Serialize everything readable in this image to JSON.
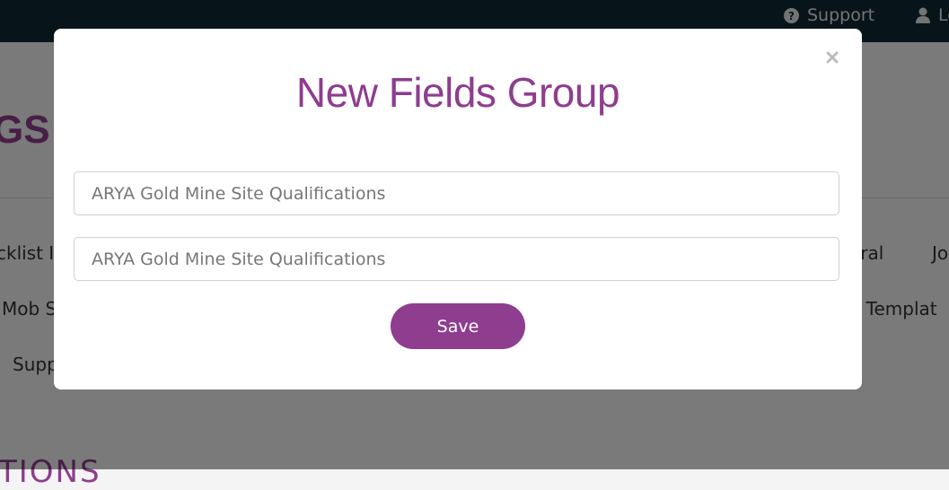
{
  "topbar": {
    "support_label": "Support",
    "logout_label": "Lo"
  },
  "background": {
    "heading": "GS",
    "tabs_row1": [
      "cklist It",
      "eral",
      "Jo"
    ],
    "tabs_row2": [
      "Mob S",
      "e Templat"
    ],
    "tabs_row3": [
      "Supp"
    ],
    "section_heading": "TIONS"
  },
  "modal": {
    "title": "New Fields Group",
    "field1_placeholder": "ARYA Gold Mine Site Qualifications",
    "field2_placeholder": "ARYA Gold Mine Site Qualifications",
    "save_label": "Save"
  },
  "colors": {
    "brand": "#8e3d8f",
    "topbar": "#0e2a35"
  },
  "icons": [
    "question-circle-icon",
    "user-icon",
    "close-icon"
  ]
}
